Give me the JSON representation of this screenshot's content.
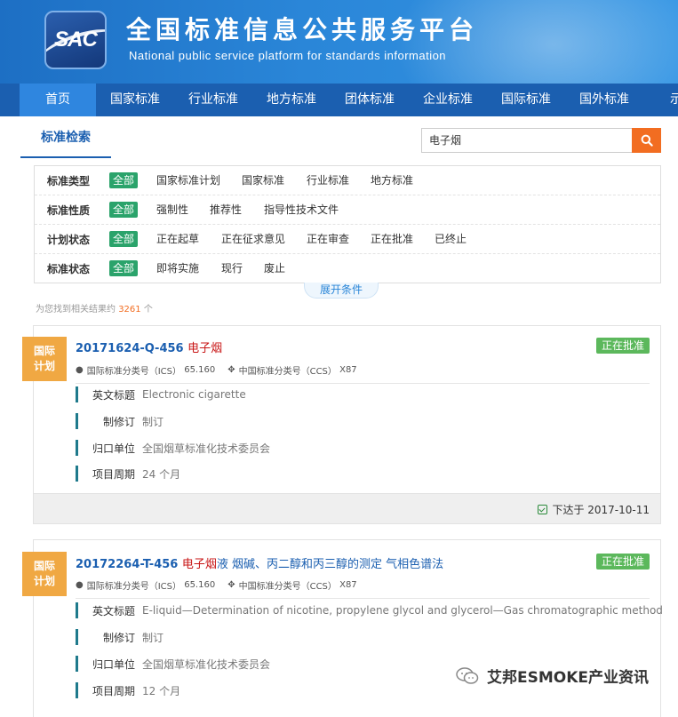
{
  "header": {
    "logo_text": "SAC",
    "title": "全国标准信息公共服务平台",
    "subtitle": "National public service platform  for standards information"
  },
  "nav": {
    "items": [
      "首页",
      "国家标准",
      "行业标准",
      "地方标准",
      "团体标准",
      "企业标准",
      "国际标准",
      "国外标准",
      "示范"
    ]
  },
  "search": {
    "tab_label": "标准检索",
    "query": "电子烟",
    "button_icon": "search-icon"
  },
  "filters": {
    "rows": [
      {
        "label": "标准类型",
        "options": [
          "全部",
          "国家标准计划",
          "国家标准",
          "行业标准",
          "地方标准"
        ],
        "active": "全部"
      },
      {
        "label": "标准性质",
        "options": [
          "全部",
          "强制性",
          "推荐性",
          "指导性技术文件"
        ],
        "active": "全部"
      },
      {
        "label": "计划状态",
        "options": [
          "全部",
          "正在起草",
          "正在征求意见",
          "正在审查",
          "正在批准",
          "已终止"
        ],
        "active": "全部"
      },
      {
        "label": "标准状态",
        "options": [
          "全部",
          "即将实施",
          "现行",
          "废止"
        ],
        "active": "全部"
      }
    ],
    "expand_label": "展开条件"
  },
  "results": {
    "count_prefix": "为您找到相关结果约",
    "count": "3261",
    "count_suffix": "个"
  },
  "cards": [
    {
      "badge": "国际计划",
      "badge_l1": "国际",
      "badge_l2": "计划",
      "code": "20171624-Q-456",
      "title_highlight": "电子烟",
      "title_rest": "",
      "status": "正在批准",
      "ics_label": "国际标准分类号（ICS）",
      "ics": "65.160",
      "ccs_label": "中国标准分类号（CCS）",
      "ccs": "X87",
      "fields": [
        {
          "label": "英文标题",
          "value": "Electronic cigarette"
        },
        {
          "label": "制修订",
          "value": "制订"
        },
        {
          "label": "归口单位",
          "value": "全国烟草标准化技术委员会"
        },
        {
          "label": "项目周期",
          "value": "24 个月"
        }
      ],
      "footer_date": "下达于 2017-10-11"
    },
    {
      "badge": "国际计划",
      "badge_l1": "国际",
      "badge_l2": "计划",
      "code": "20172264-T-456",
      "title_highlight": "电子烟",
      "title_rest": "液 烟碱、丙二醇和丙三醇的测定 气相色谱法",
      "status": "正在批准",
      "ics_label": "国际标准分类号（ICS）",
      "ics": "65.160",
      "ccs_label": "中国标准分类号（CCS）",
      "ccs": "X87",
      "fields": [
        {
          "label": "英文标题",
          "value": "E-liquid—Determination of nicotine, propylene glycol and glycerol—Gas chromatographic method"
        },
        {
          "label": "制修订",
          "value": "制订"
        },
        {
          "label": "归口单位",
          "value": "全国烟草标准化技术委员会"
        },
        {
          "label": "项目周期",
          "value": "12 个月"
        }
      ]
    }
  ],
  "watermark": {
    "text": "艾邦ESMOKE产业资讯"
  },
  "colors": {
    "header_blue": "#2a86d8",
    "nav_blue": "#1b5fb0",
    "active_green": "#2ba36b",
    "badge_orange": "#f0a843",
    "search_orange": "#f26d21",
    "status_green": "#5cb85c",
    "highlight_red": "#c81616"
  }
}
